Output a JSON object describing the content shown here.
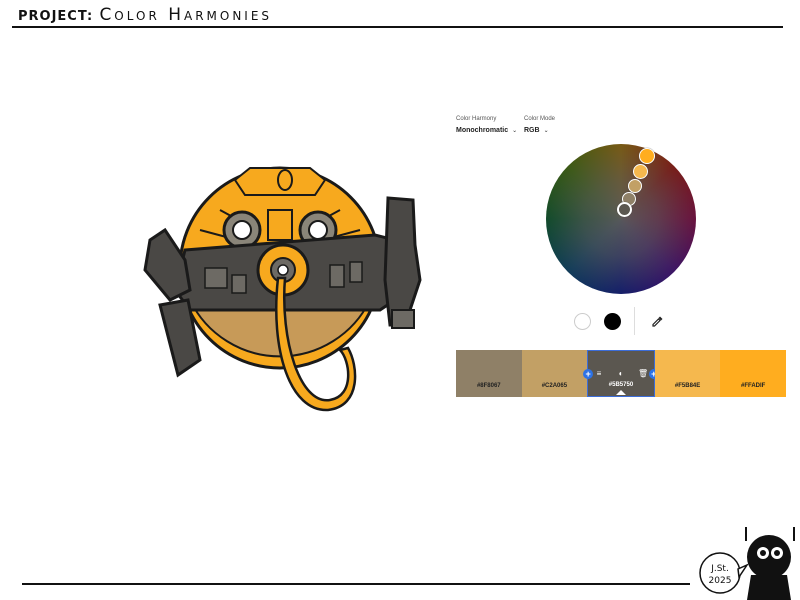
{
  "header": {
    "label": "PROJECT:",
    "title": "Color Harmonies"
  },
  "controls": {
    "harmony": {
      "label": "Color Harmony",
      "value": "Monochromatic",
      "icon": "chevron-down-icon"
    },
    "mode": {
      "label": "Color Mode",
      "value": "RGB",
      "icon": "chevron-down-icon"
    }
  },
  "wheel": {
    "handle_colors": [
      "#FFADIF",
      "#F5B84E",
      "#C2A065",
      "#8F8067",
      "#5B5750"
    ]
  },
  "wheel_buttons": {
    "light": "#FFFFFF",
    "dark": "#000000",
    "eyedropper": "eyedropper-icon"
  },
  "swatches": [
    {
      "hex": "#8F8067",
      "color": "#8F8067",
      "text_color": "#222222"
    },
    {
      "hex": "#C2A065",
      "color": "#C2A065",
      "text_color": "#222222"
    },
    {
      "hex": "#5B5750",
      "color": "#5B5750",
      "text_color": "#FFFFFF",
      "selected": true
    },
    {
      "hex": "#F5B84E",
      "color": "#F5B84E",
      "text_color": "#222222"
    },
    {
      "hex": "#FFADIF",
      "color": "#FFAD1F",
      "text_color": "#222222"
    }
  ],
  "swatch_tools": [
    "sliders-icon",
    "contrast-icon",
    "trash-icon"
  ],
  "signature": {
    "initials": "J.St.",
    "year": "2025"
  }
}
